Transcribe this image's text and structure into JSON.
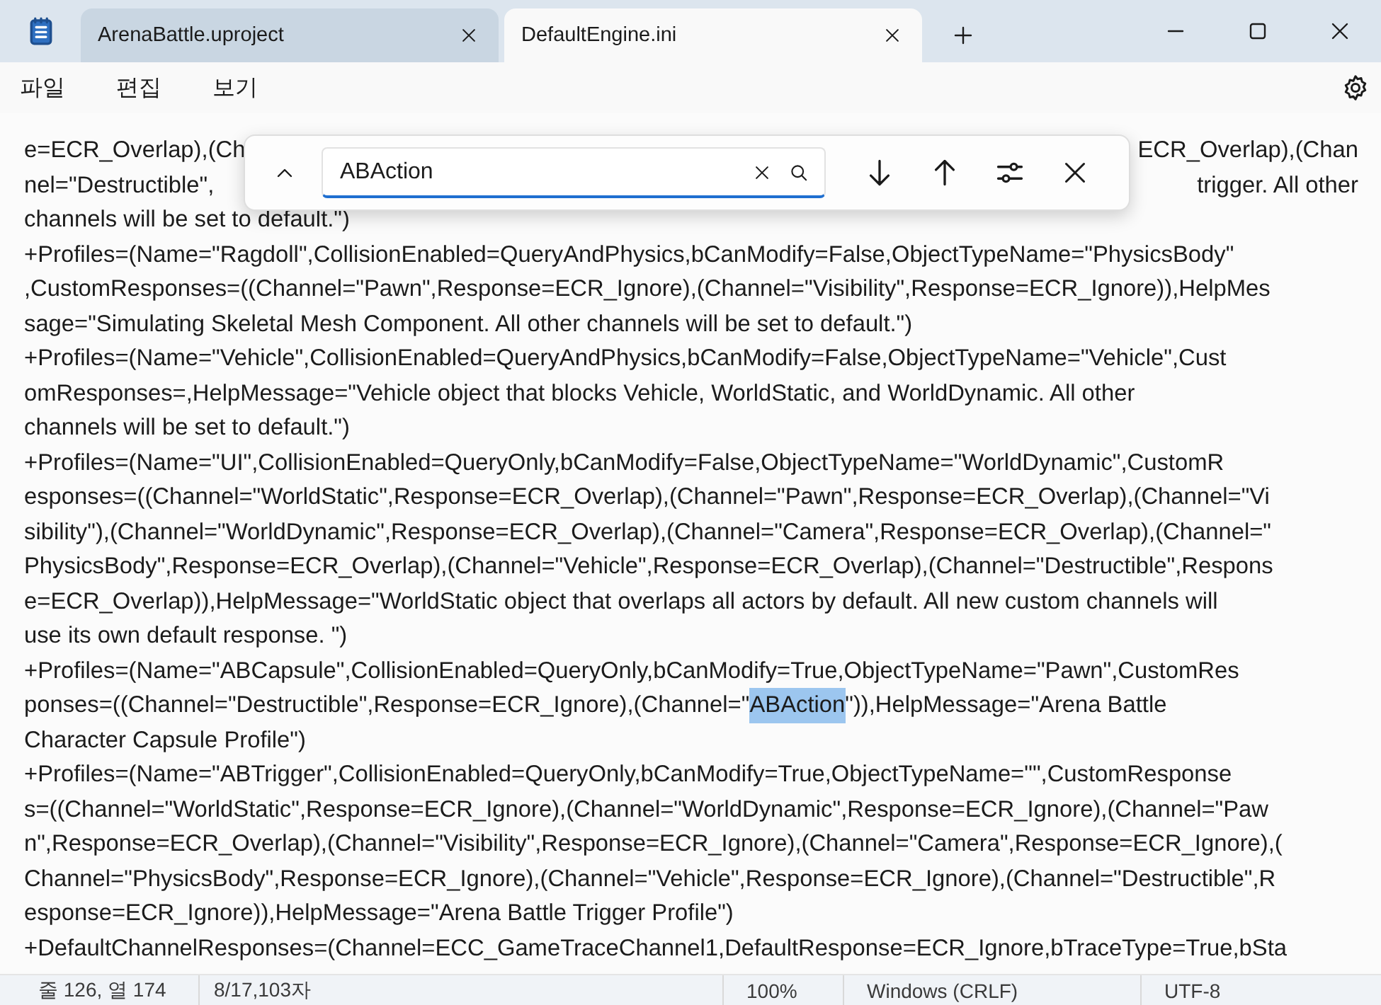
{
  "tabs": [
    {
      "title": "ArenaBattle.uproject",
      "selected": false
    },
    {
      "title": "DefaultEngine.ini",
      "selected": true
    }
  ],
  "menu": [
    "파일",
    "편집",
    "보기"
  ],
  "find": {
    "value": "ABAction"
  },
  "lines": [
    {
      "kind": "split",
      "left": "e=ECR_Overlap),(Ch",
      "right": "ECR_Overlap),(Chan"
    },
    {
      "kind": "split",
      "left": "nel=\"Destructible\",",
      "right": "trigger. All other"
    },
    {
      "kind": "plain",
      "text": "channels will be set to default.\")"
    },
    {
      "kind": "plain",
      "text": "+Profiles=(Name=\"Ragdoll\",CollisionEnabled=QueryAndPhysics,bCanModify=False,ObjectTypeName=\"PhysicsBody\""
    },
    {
      "kind": "plain",
      "text": ",CustomResponses=((Channel=\"Pawn\",Response=ECR_Ignore),(Channel=\"Visibility\",Response=ECR_Ignore)),HelpMes"
    },
    {
      "kind": "plain",
      "text": "sage=\"Simulating Skeletal Mesh Component. All other channels will be set to default.\")"
    },
    {
      "kind": "plain",
      "text": "+Profiles=(Name=\"Vehicle\",CollisionEnabled=QueryAndPhysics,bCanModify=False,ObjectTypeName=\"Vehicle\",Cust"
    },
    {
      "kind": "plain",
      "text": "omResponses=,HelpMessage=\"Vehicle object that blocks Vehicle, WorldStatic, and WorldDynamic. All other"
    },
    {
      "kind": "plain",
      "text": "channels will be set to default.\")"
    },
    {
      "kind": "plain",
      "text": "+Profiles=(Name=\"UI\",CollisionEnabled=QueryOnly,bCanModify=False,ObjectTypeName=\"WorldDynamic\",CustomR"
    },
    {
      "kind": "plain",
      "text": "esponses=((Channel=\"WorldStatic\",Response=ECR_Overlap),(Channel=\"Pawn\",Response=ECR_Overlap),(Channel=\"Vi"
    },
    {
      "kind": "plain",
      "text": "sibility\"),(Channel=\"WorldDynamic\",Response=ECR_Overlap),(Channel=\"Camera\",Response=ECR_Overlap),(Channel=\""
    },
    {
      "kind": "plain",
      "text": "PhysicsBody\",Response=ECR_Overlap),(Channel=\"Vehicle\",Response=ECR_Overlap),(Channel=\"Destructible\",Respons"
    },
    {
      "kind": "plain",
      "text": "e=ECR_Overlap)),HelpMessage=\"WorldStatic object that overlaps all actors by default. All new custom channels will"
    },
    {
      "kind": "plain",
      "text": "use its own default response. \")"
    },
    {
      "kind": "plain",
      "text": "+Profiles=(Name=\"ABCapsule\",CollisionEnabled=QueryOnly,bCanModify=True,ObjectTypeName=\"Pawn\",CustomRes"
    },
    {
      "kind": "match",
      "before": "ponses=((Channel=\"Destructible\",Response=ECR_Ignore),(Channel=\"",
      "match": "ABAction",
      "after": "\")),HelpMessage=\"Arena Battle"
    },
    {
      "kind": "plain",
      "text": "Character Capsule Profile\")"
    },
    {
      "kind": "plain",
      "text": "+Profiles=(Name=\"ABTrigger\",CollisionEnabled=QueryOnly,bCanModify=True,ObjectTypeName=\"\",CustomResponse"
    },
    {
      "kind": "plain",
      "text": "s=((Channel=\"WorldStatic\",Response=ECR_Ignore),(Channel=\"WorldDynamic\",Response=ECR_Ignore),(Channel=\"Paw"
    },
    {
      "kind": "plain",
      "text": "n\",Response=ECR_Overlap),(Channel=\"Visibility\",Response=ECR_Ignore),(Channel=\"Camera\",Response=ECR_Ignore),("
    },
    {
      "kind": "plain",
      "text": "Channel=\"PhysicsBody\",Response=ECR_Ignore),(Channel=\"Vehicle\",Response=ECR_Ignore),(Channel=\"Destructible\",R"
    },
    {
      "kind": "plain",
      "text": "esponse=ECR_Ignore)),HelpMessage=\"Arena Battle Trigger Profile\")"
    },
    {
      "kind": "plain",
      "text": "+DefaultChannelResponses=(Channel=ECC_GameTraceChannel1,DefaultResponse=ECR_Ignore,bTraceType=True,bSta"
    }
  ],
  "status_bar": {
    "position": "줄 126, 열 174",
    "count": "8/17,103자",
    "zoom": "100%",
    "line_ending": "Windows (CRLF)",
    "encoding": "UTF-8"
  }
}
